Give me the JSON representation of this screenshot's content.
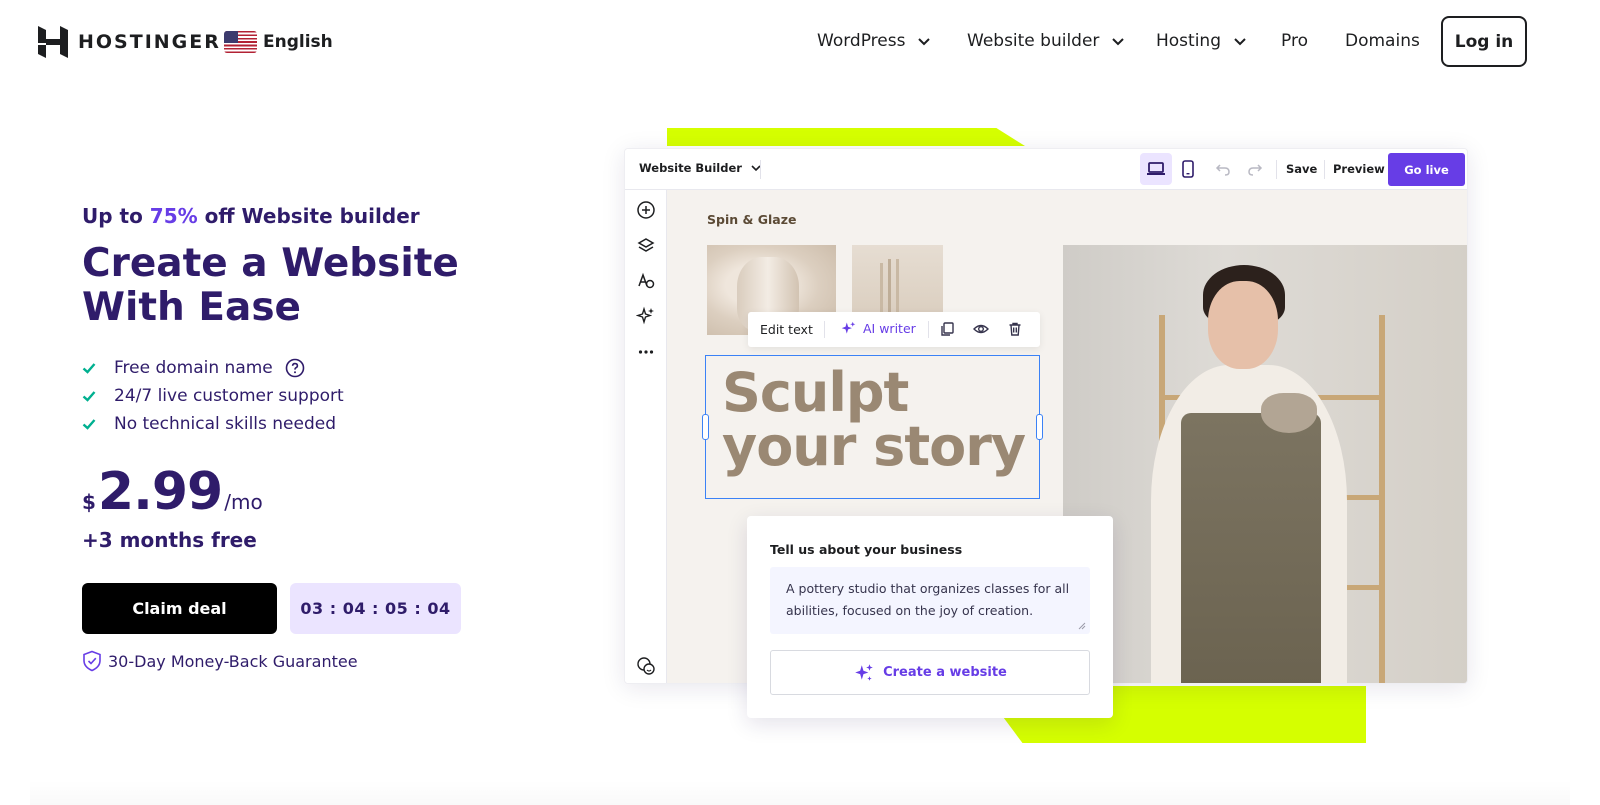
{
  "header": {
    "logo_text": "HOSTINGER",
    "language": "English",
    "nav": [
      {
        "label": "WordPress",
        "has_dropdown": true
      },
      {
        "label": "Website builder",
        "has_dropdown": true
      },
      {
        "label": "Hosting",
        "has_dropdown": true
      },
      {
        "label": "Pro",
        "has_dropdown": false
      },
      {
        "label": "Domains",
        "has_dropdown": false
      }
    ],
    "login_label": "Log in"
  },
  "hero": {
    "promo_prefix": "Up to ",
    "promo_highlight": "75%",
    "promo_suffix": " off Website builder",
    "title": "Create a Website With Ease",
    "features": [
      "Free domain name",
      "24/7 live customer support",
      "No technical skills needed"
    ],
    "price_currency": "$",
    "price_amount": "2.99",
    "price_period": "/mo",
    "bonus": "+3 months free",
    "cta_label": "Claim deal",
    "countdown": "03 : 04 : 05 : 04",
    "guarantee": "30-Day Money-Back Guarantee"
  },
  "builder": {
    "title": "Website Builder",
    "save_label": "Save",
    "preview_label": "Preview",
    "golive_label": "Go live",
    "site_name": "Spin & Glaze",
    "edit_text_label": "Edit text",
    "ai_writer_label": "AI writer",
    "headline_line1": "Sculpt",
    "headline_line2": "your story"
  },
  "business_card": {
    "label": "Tell us about your business",
    "description": "A pottery studio that organizes classes for all abilities, focused on the joy of creation.",
    "button_label": "Create a website"
  },
  "colors": {
    "brand_purple": "#673de6",
    "text_navy": "#2f1c6a",
    "accent_lime": "#d5ff00",
    "timer_bg": "#ebe4ff",
    "check_green": "#00b090"
  }
}
